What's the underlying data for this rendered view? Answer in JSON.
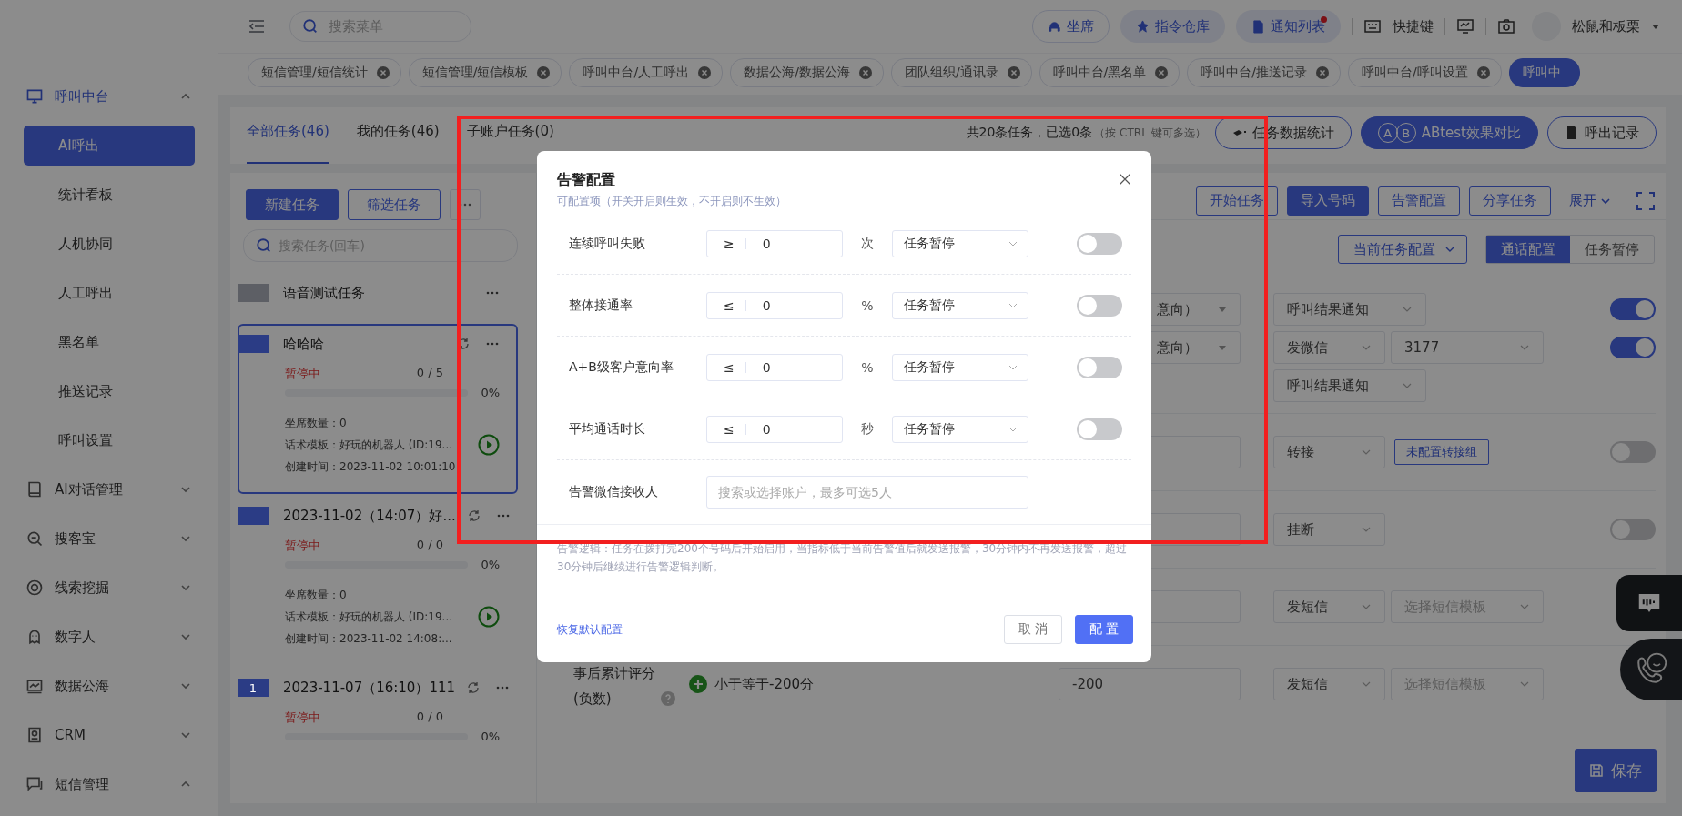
{
  "sidebar": {
    "items": [
      {
        "label": "呼叫中台",
        "expanded": true,
        "children": [
          {
            "label": "AI呼出",
            "selected": true
          },
          {
            "label": "统计看板",
            "selected": false
          },
          {
            "label": "人机协同",
            "selected": false
          },
          {
            "label": "人工呼出",
            "selected": false
          },
          {
            "label": "黑名单",
            "selected": false
          },
          {
            "label": "推送记录",
            "selected": false
          },
          {
            "label": "呼叫设置",
            "selected": false
          }
        ]
      },
      {
        "label": "AI对话管理",
        "expanded": false
      },
      {
        "label": "搜客宝",
        "expanded": false
      },
      {
        "label": "线索挖掘",
        "expanded": false
      },
      {
        "label": "数字人",
        "expanded": false
      },
      {
        "label": "数据公海",
        "expanded": false
      },
      {
        "label": "CRM",
        "expanded": false
      },
      {
        "label": "短信管理",
        "expanded": true
      }
    ]
  },
  "topbar": {
    "search_placeholder": "搜索菜单",
    "buttons": [
      {
        "label": "坐席",
        "kind": "outline",
        "unread": false
      },
      {
        "label": "指令仓库",
        "kind": "filled",
        "unread": false
      },
      {
        "label": "通知列表",
        "kind": "filled",
        "unread": true
      }
    ],
    "shortcut": "快捷键",
    "user": "松鼠和板栗"
  },
  "open_tabs": [
    {
      "label": "短信管理/短信统计",
      "selected": false
    },
    {
      "label": "短信管理/短信模板",
      "selected": false
    },
    {
      "label": "呼叫中台/人工呼出",
      "selected": false
    },
    {
      "label": "数据公海/数据公海",
      "selected": false
    },
    {
      "label": "团队组织/通讯录",
      "selected": false
    },
    {
      "label": "呼叫中台/黑名单",
      "selected": false
    },
    {
      "label": "呼叫中台/推送记录",
      "selected": false
    },
    {
      "label": "呼叫中台/呼叫设置",
      "selected": false
    },
    {
      "label": "呼叫中",
      "selected": true
    }
  ],
  "task_tabs": [
    {
      "label": "全部任务(46)",
      "selected": true
    },
    {
      "label": "我的任务(46)",
      "selected": false
    },
    {
      "label": "子账户任务(0)",
      "selected": false
    }
  ],
  "summary": "共20条任务，已选0条",
  "summary_hint": "（按 CTRL 键可多选）",
  "header_buttons": [
    {
      "label": "任务数据统计",
      "kind": "outline"
    },
    {
      "label": "ABtest效果对比",
      "kind": "filled",
      "icon_letters": [
        "A",
        "B"
      ]
    },
    {
      "label": "呼出记录",
      "kind": "outline"
    }
  ],
  "task_list": {
    "new_button": "新建任务",
    "filter_button": "筛选任务",
    "search_placeholder": "搜索任务(回车)",
    "tasks": [
      {
        "kind": "group",
        "title": "语音测试任务",
        "color": "#5d5f65",
        "selected": false
      },
      {
        "kind": "task",
        "title": "哈哈哈",
        "color": "#2b3c85",
        "selected": true,
        "status": "暂停中",
        "count": "0 / 5",
        "level": 0,
        "percent": "0%",
        "details": [
          "坐席数量：0",
          "话术模板：好玩的机器人 (ID:19...",
          "创建时间：2023-11-02 10:01:10"
        ]
      },
      {
        "kind": "task",
        "title": "2023-11-02（14:07）好...",
        "color": "#2b3c85",
        "selected": false,
        "status": "暂停中",
        "count": "0 / 0",
        "level": 0,
        "percent": "0%",
        "details": [
          "坐席数量：0",
          "话术模板：好玩的机器人 (ID:19...",
          "创建时间：2023-11-02 14:08:..."
        ]
      },
      {
        "kind": "task",
        "title": "2023-11-07（16:10）111",
        "color": "#2b3c85",
        "badge": "1",
        "selected": false,
        "status": "暂停中",
        "count": "0 / 0",
        "level": 0,
        "percent": "0%"
      }
    ]
  },
  "config": {
    "toolbar": [
      {
        "label": "开始任务",
        "kind": "outline"
      },
      {
        "label": "导入号码",
        "kind": "filled"
      },
      {
        "label": "告警配置",
        "kind": "outline"
      },
      {
        "label": "分享任务",
        "kind": "outline"
      }
    ],
    "expand": "展开",
    "scope_dropdown": "当前任务配置",
    "segments": [
      {
        "label": "通话配置",
        "selected": true
      },
      {
        "label": "任务暂停",
        "selected": false
      }
    ],
    "rules": [
      {
        "lines": [
          {
            "condition_select": "意向）",
            "action": "呼叫结果通知",
            "on": true
          },
          {
            "condition_select": "意向）",
            "action": "发微信",
            "extra": "3177",
            "on": true
          },
          {
            "action": "呼叫结果通知"
          }
        ]
      },
      {
        "lines": [
          {
            "value_field": true,
            "action": "转接",
            "extra_button": "未配置转接组",
            "on": false
          }
        ]
      },
      {
        "lines": [
          {
            "value_field": true,
            "action": "挂断",
            "on": false
          }
        ]
      },
      {
        "lines": [
          {
            "value_field": true,
            "action": "发短信",
            "extra_placeholder": "选择短信模板"
          }
        ]
      },
      {
        "label": "事后累计评分(负数)",
        "condition": "小于等于-200分",
        "lines": [
          {
            "value": "-200",
            "action": "发短信",
            "extra_placeholder": "选择短信模板"
          }
        ]
      }
    ],
    "save": "保存"
  },
  "dialog": {
    "title": "告警配置",
    "subtitle": "可配置项（开关开启则生效，不开启则不生效）",
    "rows": [
      {
        "label": "连续呼叫失败",
        "operator": "≥",
        "value": "0",
        "unit": "次",
        "action": "任务暂停",
        "on": false
      },
      {
        "label": "整体接通率",
        "operator": "≤",
        "value": "0",
        "unit": "%",
        "action": "任务暂停",
        "on": false
      },
      {
        "label": "A+B级客户意向率",
        "operator": "≤",
        "value": "0",
        "unit": "%",
        "action": "任务暂停",
        "on": false
      },
      {
        "label": "平均通话时长",
        "operator": "≤",
        "value": "0",
        "unit": "秒",
        "action": "任务暂停",
        "on": false
      }
    ],
    "receiver": {
      "label": "告警微信接收人",
      "placeholder": "搜索或选择账户，最多可选5人"
    },
    "note": "告警逻辑：任务在拨打完200个号码后开始启用，当指标低于当前告警值后就发送报警，30分钟内不再发送报警，超过30分钟后继续进行告警逻辑判断。",
    "reset": "恢复默认配置",
    "cancel": "取 消",
    "confirm": "配 置"
  }
}
